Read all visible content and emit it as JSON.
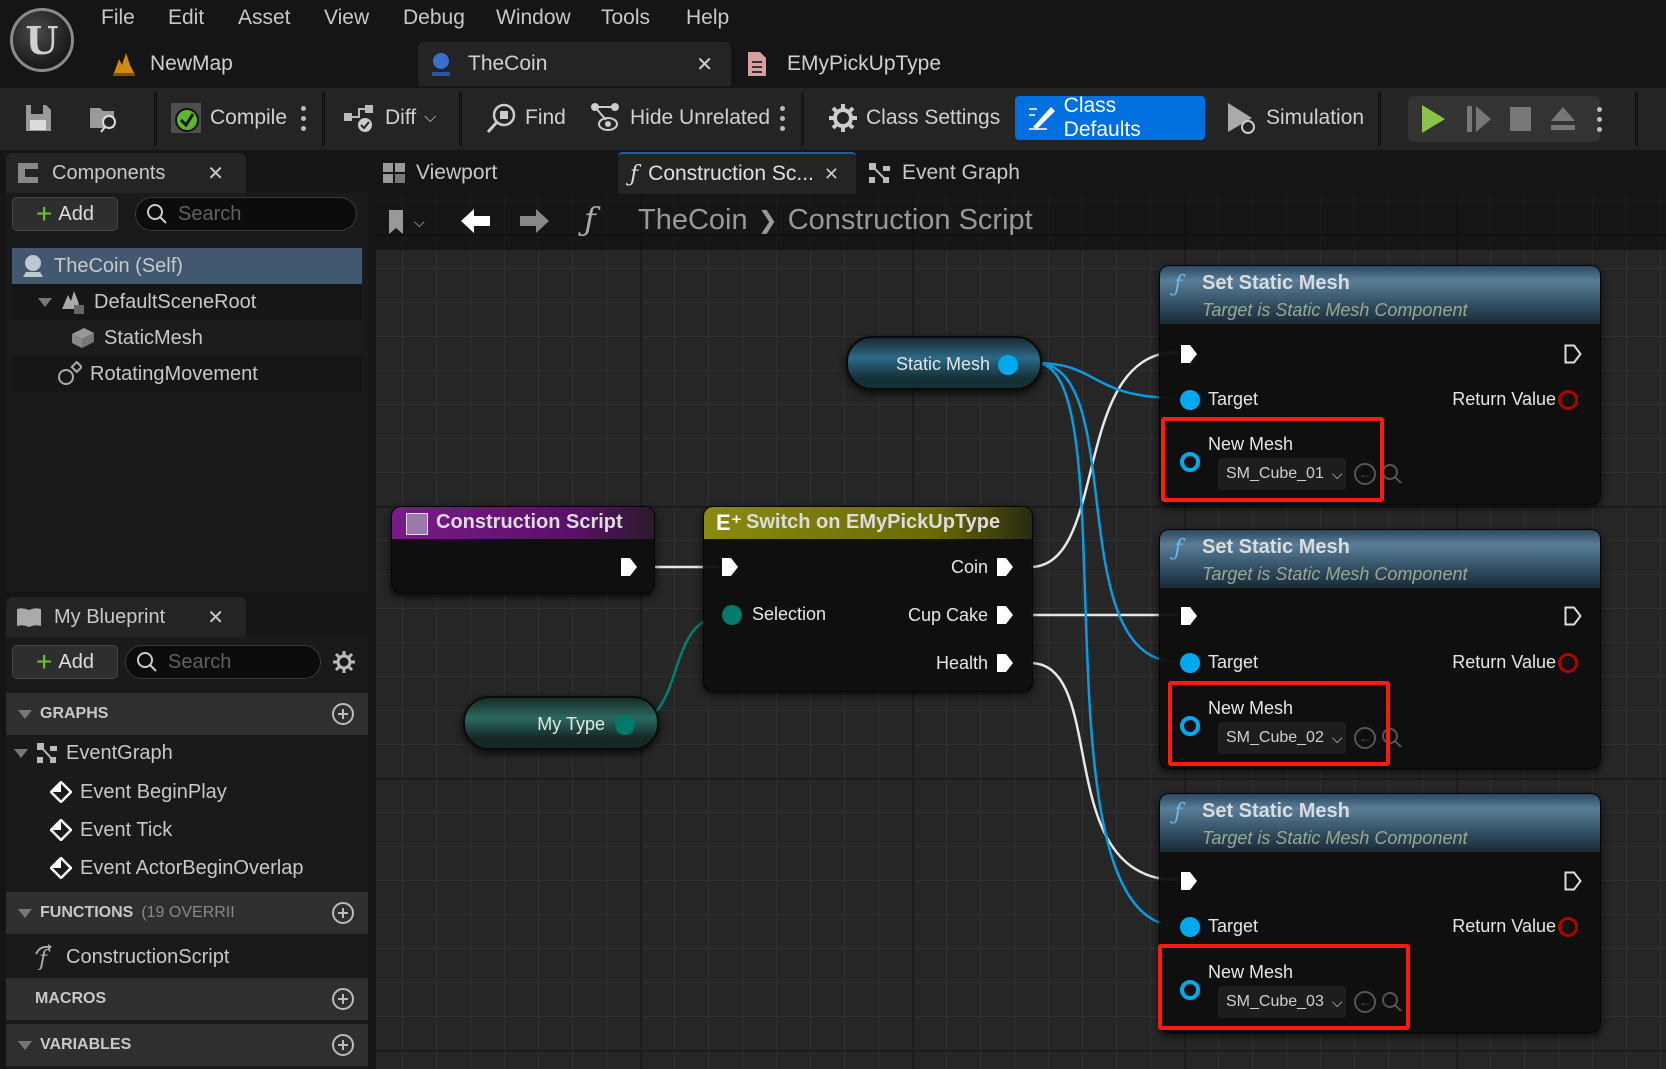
{
  "app": {
    "logo": "U",
    "menu": [
      "File",
      "Edit",
      "Asset",
      "View",
      "Debug",
      "Window",
      "Tools",
      "Help"
    ],
    "doc_tabs": [
      {
        "label": "NewMap",
        "icon": "level-icon"
      },
      {
        "label": "TheCoin",
        "icon": "blueprint-icon",
        "active": true
      },
      {
        "label": "EMyPickUpType",
        "icon": "enum-icon"
      }
    ]
  },
  "toolbar": {
    "compile": "Compile",
    "diff": "Diff",
    "find": "Find",
    "hide_unrelated": "Hide Unrelated",
    "class_settings": "Class Settings",
    "class_defaults": "Class Defaults",
    "simulation": "Simulation",
    "accent_color": "#0070e0",
    "play_color": "#8bc34a"
  },
  "components_panel": {
    "title": "Components",
    "add_label": "Add",
    "search_placeholder": "Search",
    "items": [
      {
        "label": "TheCoin (Self)",
        "selected": true
      },
      {
        "label": "DefaultSceneRoot"
      },
      {
        "label": "StaticMesh"
      },
      {
        "label": "RotatingMovement"
      }
    ]
  },
  "my_blueprint_panel": {
    "title": "My Blueprint",
    "add_label": "Add",
    "search_placeholder": "Search",
    "sections": {
      "graphs": "GRAPHS",
      "functions": "FUNCTIONS",
      "functions_suffix": "(19 OVERRII",
      "macros": "MACROS",
      "variables": "VARIABLES"
    },
    "graphs": [
      "EventGraph"
    ],
    "events": [
      "Event BeginPlay",
      "Event Tick",
      "Event ActorBeginOverlap"
    ],
    "functions": [
      "ConstructionScript"
    ]
  },
  "graph_tabs": [
    {
      "label": "Viewport"
    },
    {
      "label": "Construction Sc...",
      "active": true
    },
    {
      "label": "Event Graph"
    }
  ],
  "breadcrumb": {
    "root": "TheCoin",
    "current": "Construction Script"
  },
  "nodes": {
    "construction_script": {
      "title": "Construction Script"
    },
    "switch": {
      "title": "Switch on EMyPickUpType",
      "selection": "Selection",
      "outputs": [
        "Coin",
        "Cup Cake",
        "Health"
      ]
    },
    "static_mesh_var": {
      "label": "Static Mesh"
    },
    "my_type_var": {
      "label": "My Type"
    },
    "set_static_mesh": [
      {
        "title": "Set Static Mesh",
        "subtitle": "Target is Static Mesh Component",
        "target": "Target",
        "return": "Return Value",
        "new_mesh": "New Mesh",
        "value": "SM_Cube_01"
      },
      {
        "title": "Set Static Mesh",
        "subtitle": "Target is Static Mesh Component",
        "target": "Target",
        "return": "Return Value",
        "new_mesh": "New Mesh",
        "value": "SM_Cube_02"
      },
      {
        "title": "Set Static Mesh",
        "subtitle": "Target is Static Mesh Component",
        "target": "Target",
        "return": "Return Value",
        "new_mesh": "New Mesh",
        "value": "SM_Cube_03"
      }
    ]
  },
  "colors": {
    "object_pin": "#00a8f0",
    "enum_pin": "#007a6a",
    "highlight": "#ff1a10",
    "return_pin": "#b00000"
  }
}
